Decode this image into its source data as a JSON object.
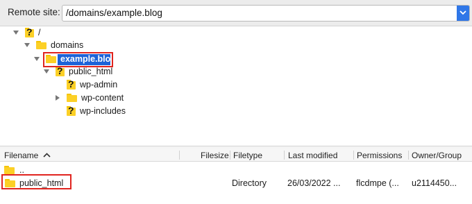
{
  "topbar": {
    "label": "Remote site:",
    "path": "/domains/example.blog"
  },
  "tree": {
    "root": "/",
    "domains": "domains",
    "example": "example.blog",
    "public_html": "public_html",
    "wp_admin": "wp-admin",
    "wp_content": "wp-content",
    "wp_includes": "wp-includes"
  },
  "list": {
    "columns": [
      "Filename",
      "Filesize",
      "Filetype",
      "Last modified",
      "Permissions",
      "Owner/Group"
    ],
    "sort_column": "Filename",
    "rows": [
      {
        "name": "..",
        "size": "",
        "type": "",
        "modified": "",
        "perms": "",
        "owner": ""
      },
      {
        "name": "public_html",
        "size": "",
        "type": "Directory",
        "modified": "26/03/2022 ...",
        "perms": "flcdmpe (...",
        "owner": "u2114450..."
      }
    ]
  },
  "colors": {
    "selection": "#1d63d8",
    "highlight_box": "#e0241f",
    "folder": "#fcd026"
  }
}
